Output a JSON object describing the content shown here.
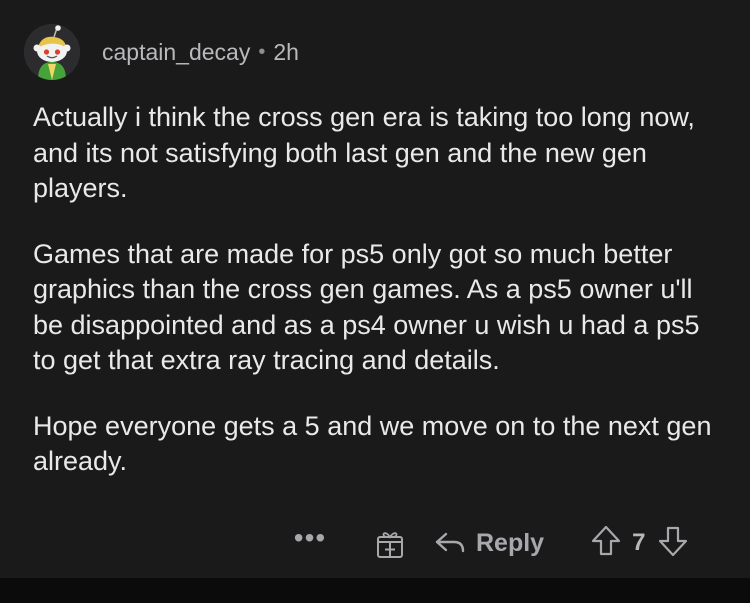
{
  "comment": {
    "author": "captain_decay",
    "separator": "•",
    "time": "2h",
    "paragraphs": [
      "Actually i think the cross gen era is taking too long now, and its not satisfying both last gen and the new gen players.",
      "Games that are made for ps5 only got so much better graphics than the cross gen games. As a ps5 owner u'll be disappointed and as a ps4 owner u wish u had a ps5 to get that extra ray tracing and details.",
      "Hope everyone gets a 5 and we move on to the next gen already."
    ]
  },
  "actions": {
    "more_label": "•••",
    "reply_label": "Reply",
    "score": "7"
  },
  "colors": {
    "background": "#1a1a1b",
    "text": "#e9e9ea",
    "muted": "#a8a8ac"
  },
  "icons": [
    "snoo-avatar",
    "more-icon",
    "award-icon",
    "reply-arrow-icon",
    "upvote-icon",
    "downvote-icon"
  ]
}
